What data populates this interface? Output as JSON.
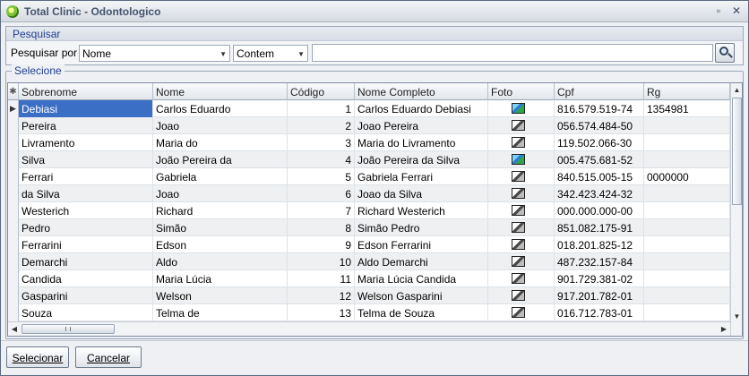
{
  "window": {
    "title": "Total Clinic - Odontologico",
    "restore_glyph": "▫",
    "close_glyph": "✕",
    "icon": "app-logo-icon"
  },
  "search": {
    "group_label": "Pesquisar",
    "label": "Pesquisar por",
    "field_value": "Nome",
    "operator_value": "Contem",
    "text_value": "",
    "button_icon": "magnifier-icon"
  },
  "grid": {
    "group_label": "Selecione",
    "columns": [
      "Sobrenome",
      "Nome",
      "Código",
      "Nome Completo",
      "Foto",
      "Cpf",
      "Rg"
    ],
    "selected_row": 0,
    "rows": [
      {
        "sobrenome": "Debiasi",
        "nome": "Carlos Eduardo",
        "codigo": "1",
        "nome_completo": "Carlos Eduardo Debiasi",
        "foto": "photo-color-icon",
        "cpf": "816.579.519-74",
        "rg": "1354981"
      },
      {
        "sobrenome": "Pereira",
        "nome": "Joao",
        "codigo": "2",
        "nome_completo": "Joao Pereira",
        "foto": "photo-placeholder-icon",
        "cpf": "056.574.484-50",
        "rg": ""
      },
      {
        "sobrenome": "Livramento",
        "nome": "Maria do",
        "codigo": "3",
        "nome_completo": "Maria do Livramento",
        "foto": "photo-placeholder-icon",
        "cpf": "119.502.066-30",
        "rg": ""
      },
      {
        "sobrenome": "Silva",
        "nome": "João Pereira da",
        "codigo": "4",
        "nome_completo": "João Pereira da Silva",
        "foto": "photo-color-icon",
        "cpf": "005.475.681-52",
        "rg": ""
      },
      {
        "sobrenome": "Ferrari",
        "nome": "Gabriela",
        "codigo": "5",
        "nome_completo": "Gabriela Ferrari",
        "foto": "photo-placeholder-icon",
        "cpf": "840.515.005-15",
        "rg": "0000000"
      },
      {
        "sobrenome": "da Silva",
        "nome": "Joao",
        "codigo": "6",
        "nome_completo": "Joao da Silva",
        "foto": "photo-placeholder-icon",
        "cpf": "342.423.424-32",
        "rg": ""
      },
      {
        "sobrenome": "Westerich",
        "nome": "Richard",
        "codigo": "7",
        "nome_completo": "Richard Westerich",
        "foto": "photo-placeholder-icon",
        "cpf": "000.000.000-00",
        "rg": ""
      },
      {
        "sobrenome": "Pedro",
        "nome": "Simão",
        "codigo": "8",
        "nome_completo": "Simão Pedro",
        "foto": "photo-placeholder-icon",
        "cpf": "851.082.175-91",
        "rg": ""
      },
      {
        "sobrenome": "Ferrarini",
        "nome": "Edson",
        "codigo": "9",
        "nome_completo": "Edson Ferrarini",
        "foto": "photo-placeholder-icon",
        "cpf": "018.201.825-12",
        "rg": ""
      },
      {
        "sobrenome": "Demarchi",
        "nome": "Aldo",
        "codigo": "10",
        "nome_completo": "Aldo Demarchi",
        "foto": "photo-placeholder-icon",
        "cpf": "487.232.157-84",
        "rg": ""
      },
      {
        "sobrenome": "Candida",
        "nome": "Maria Lúcia",
        "codigo": "11",
        "nome_completo": "Maria Lúcia Candida",
        "foto": "photo-placeholder-icon",
        "cpf": "901.729.381-02",
        "rg": ""
      },
      {
        "sobrenome": "Gasparini",
        "nome": "Welson",
        "codigo": "12",
        "nome_completo": "Welson Gasparini",
        "foto": "photo-placeholder-icon",
        "cpf": "917.201.782-01",
        "rg": ""
      },
      {
        "sobrenome": "Souza",
        "nome": "Telma de",
        "codigo": "13",
        "nome_completo": "Telma de Souza",
        "foto": "photo-placeholder-icon",
        "cpf": "016.712.783-01",
        "rg": ""
      }
    ]
  },
  "buttons": {
    "select_label": "Selecionar",
    "cancel_label": "Cancelar"
  },
  "colors": {
    "selection": "#3b6fc5",
    "group_label": "#1f3f8f",
    "title_text": "#44556c"
  }
}
